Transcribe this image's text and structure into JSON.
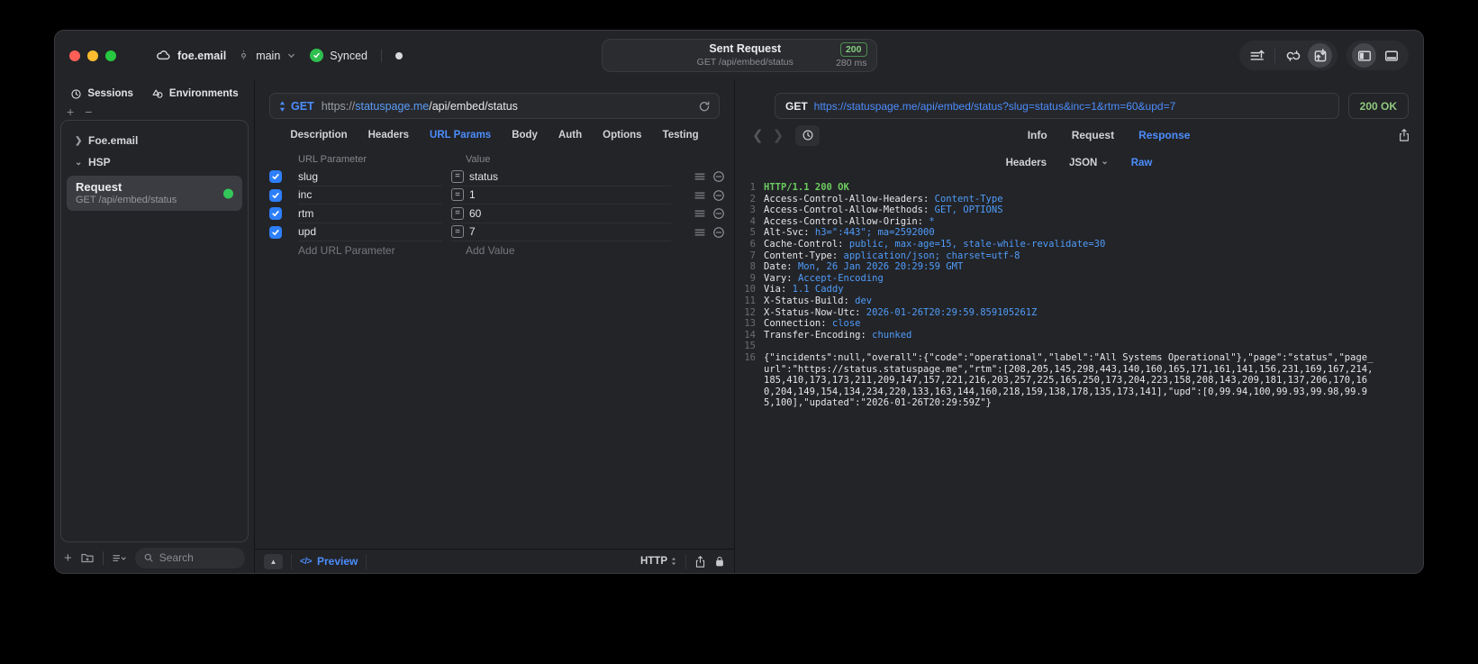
{
  "titlebar": {
    "project": "foe.email",
    "branch": "main",
    "sync_status": "Synced",
    "sent_request": {
      "title": "Sent Request",
      "subtitle": "GET /api/embed/status",
      "status_code": "200",
      "duration": "280 ms"
    }
  },
  "sidebar": {
    "tabs": [
      {
        "label": "Sessions"
      },
      {
        "label": "Environments"
      }
    ],
    "tree": [
      {
        "label": "Foe.email"
      },
      {
        "label": "HSP"
      }
    ],
    "request_item": {
      "title": "Request",
      "subtitle": "GET /api/embed/status"
    },
    "search_placeholder": "Search"
  },
  "editor": {
    "method": "GET",
    "url": {
      "scheme": "https://",
      "host": "statuspage.me",
      "path": "/api/embed/status"
    },
    "tabs": [
      "Description",
      "Headers",
      "URL Params",
      "Body",
      "Auth",
      "Options",
      "Testing"
    ],
    "active_tab": "URL Params",
    "params_table": {
      "columns": [
        "URL Parameter",
        "Value"
      ],
      "rows": [
        {
          "name": "slug",
          "value": "status",
          "enabled": true
        },
        {
          "name": "inc",
          "value": "1",
          "enabled": true
        },
        {
          "name": "rtm",
          "value": "60",
          "enabled": true
        },
        {
          "name": "upd",
          "value": "7",
          "enabled": true
        }
      ],
      "add_param_placeholder": "Add URL Parameter",
      "add_value_placeholder": "Add Value"
    },
    "footer": {
      "preview_label": "Preview",
      "code_glyph": "</>",
      "protocol": "HTTP"
    }
  },
  "response": {
    "method": "GET",
    "url": "https://statuspage.me/api/embed/status?slug=status&inc=1&rtm=60&upd=7",
    "status": "200 OK",
    "tabs": [
      "Info",
      "Request",
      "Response"
    ],
    "active_tab": "Response",
    "subtabs": [
      "Headers",
      "JSON",
      "Raw"
    ],
    "active_subtab": "Raw",
    "status_line": "HTTP/1.1 200 OK",
    "headers": [
      {
        "name": "Access-Control-Allow-Headers:",
        "value": "Content-Type"
      },
      {
        "name": "Access-Control-Allow-Methods:",
        "value": "GET, OPTIONS"
      },
      {
        "name": "Access-Control-Allow-Origin:",
        "value": "*"
      },
      {
        "name": "Alt-Svc:",
        "value": "h3=\":443\"; ma=2592000"
      },
      {
        "name": "Cache-Control:",
        "value": "public, max-age=15, stale-while-revalidate=30"
      },
      {
        "name": "Content-Type:",
        "value": "application/json; charset=utf-8"
      },
      {
        "name": "Date:",
        "value": "Mon, 26 Jan 2026 20:29:59 GMT"
      },
      {
        "name": "Vary:",
        "value": "Accept-Encoding"
      },
      {
        "name": "Via:",
        "value": "1.1 Caddy"
      },
      {
        "name": "X-Status-Build:",
        "value": "dev"
      },
      {
        "name": "X-Status-Now-Utc:",
        "value": "2026-01-26T20:29:59.859105261Z"
      },
      {
        "name": "Connection:",
        "value": "close"
      },
      {
        "name": "Transfer-Encoding:",
        "value": "chunked"
      }
    ],
    "body": "{\"incidents\":null,\"overall\":{\"code\":\"operational\",\"label\":\"All Systems Operational\"},\"page\":\"status\",\"page_url\":\"https://status.statuspage.me\",\"rtm\":[208,205,145,298,443,140,160,165,171,161,141,156,231,169,167,214,185,410,173,173,211,209,147,157,221,216,203,257,225,165,250,173,204,223,158,208,143,209,181,137,206,170,160,204,149,154,134,234,220,133,163,144,160,218,159,138,178,135,173,141],\"upd\":[0,99.94,100,99.93,99.98,99.95,100],\"updated\":\"2026-01-26T20:29:59Z\"}"
  }
}
